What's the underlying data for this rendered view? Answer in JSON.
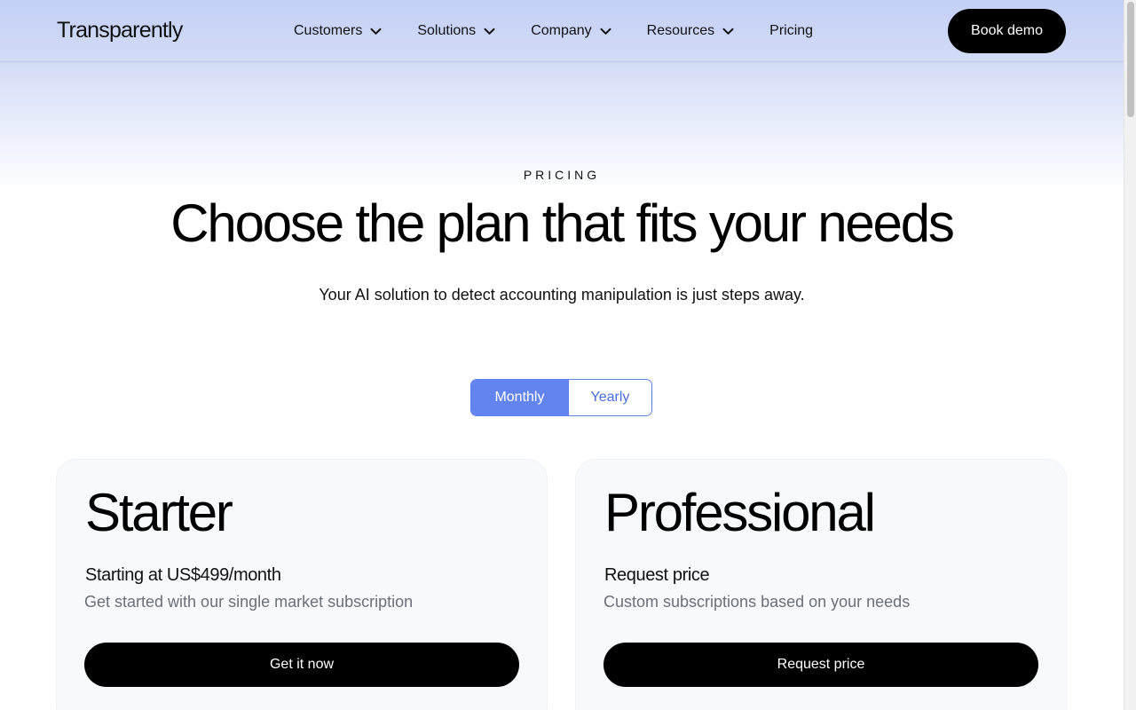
{
  "header": {
    "logo": "Transparently",
    "nav": [
      {
        "label": "Customers",
        "has_dropdown": true
      },
      {
        "label": "Solutions",
        "has_dropdown": true
      },
      {
        "label": "Company",
        "has_dropdown": true
      },
      {
        "label": "Resources",
        "has_dropdown": true
      },
      {
        "label": "Pricing",
        "has_dropdown": false
      }
    ],
    "cta_label": "Book demo"
  },
  "hero": {
    "eyebrow": "PRICING",
    "title": "Choose the plan that fits your needs",
    "subtitle": "Your AI solution to detect accounting manipulation is just steps away."
  },
  "billing_toggle": {
    "options": [
      "Monthly",
      "Yearly"
    ],
    "selected": "Monthly"
  },
  "plans": [
    {
      "name": "Starter",
      "price": "Starting at US$499/month",
      "description": "Get started with our single market subscription",
      "cta": "Get it now"
    },
    {
      "name": "Professional",
      "price": "Request price",
      "description": "Custom subscriptions based on your needs",
      "cta": "Request price"
    }
  ],
  "colors": {
    "accent": "#6384ee",
    "header_gradient_top": "#c3cff5",
    "button_bg": "#000000",
    "card_bg": "#f7f9fc"
  },
  "icons": {
    "nav_dropdown": "chevron-down-icon"
  }
}
